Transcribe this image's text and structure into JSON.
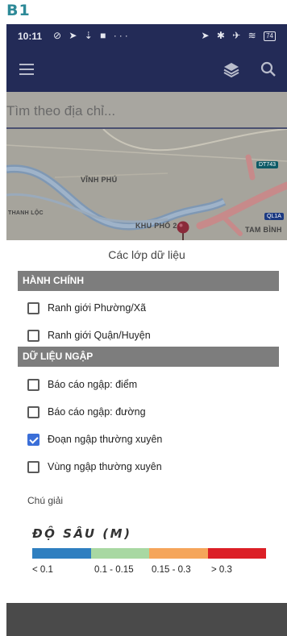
{
  "frame_label": "B1",
  "status_bar": {
    "time": "10:11",
    "left_icons": "⊘ ➤ ⇣ ■ ···",
    "right_icons": "➤ ✱ ✈ ≋",
    "battery": "74"
  },
  "search": {
    "placeholder": "Tìm theo địa chỉ..."
  },
  "map": {
    "labels": [
      "VĨNH PHÚ",
      "THANH LỘC",
      "KHU PHỐ 2",
      "TAM BÌNH"
    ],
    "road_badges": [
      "DT743",
      "QL1A"
    ]
  },
  "sheet": {
    "title": "Các lớp dữ liệu",
    "sections": [
      {
        "header": "HÀNH CHÍNH",
        "items": [
          {
            "label": "Ranh giới Phường/Xã",
            "checked": false
          },
          {
            "label": "Ranh giới Quận/Huyện",
            "checked": false
          }
        ]
      },
      {
        "header": "DỮ LIỆU NGẬP",
        "items": [
          {
            "label": "Báo cáo ngập: điểm",
            "checked": false
          },
          {
            "label": "Báo cáo ngập: đường",
            "checked": false
          },
          {
            "label": "Đoạn ngập thường xuyên",
            "checked": true
          },
          {
            "label": "Vùng ngập thường xuyên",
            "checked": false
          }
        ]
      }
    ]
  },
  "legend": {
    "title": "Chú giải",
    "heading": "ĐỘ SÂU (M)",
    "colors": [
      "#2f7fc0",
      "#a8d8a2",
      "#f5a55a",
      "#dc1f26"
    ],
    "labels": [
      "< 0.1",
      "0.1 - 0.15",
      "0.15 - 0.3",
      "> 0.3"
    ]
  }
}
